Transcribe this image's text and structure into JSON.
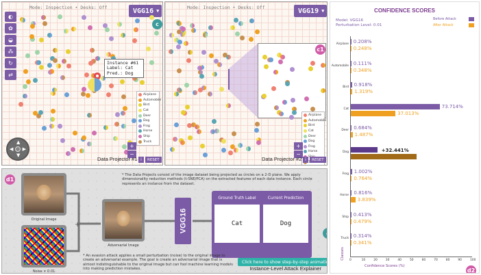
{
  "colors": {
    "accent": "#7b5aa6",
    "before_attack": "#7b5aa6",
    "after_attack": "#f0a020",
    "before_attack_dark": "#5c3a8a",
    "after_attack_dark": "#a06a18",
    "teal_button": "#2fb3a8"
  },
  "projector1": {
    "mode_text": "Mode: Inspection • Desks: Off",
    "model": "VGG16",
    "badge": "c",
    "label": "Data Projector #1",
    "info": "i",
    "reset": "RESET",
    "tooltip": {
      "instance": "Instance #61",
      "label": "Label: Cat",
      "pred": "Pred.: Dog"
    }
  },
  "projector2": {
    "mode_text": "Mode: Inspection • Desks: Off",
    "model": "VGG19",
    "badge": "c1",
    "label": "Data Projector #2",
    "info": "i",
    "reset": "RESET"
  },
  "legend": {
    "classes": [
      {
        "name": "Airplane",
        "color": "#f08070"
      },
      {
        "name": "Automobile",
        "color": "#f0a020"
      },
      {
        "name": "Bird",
        "color": "#e8d030"
      },
      {
        "name": "Cat",
        "color": "#f0e060"
      },
      {
        "name": "Deer",
        "color": "#9fd4a8"
      },
      {
        "name": "Dog",
        "color": "#6aa0d8"
      },
      {
        "name": "Frog",
        "color": "#b090d0"
      },
      {
        "name": "Horse",
        "color": "#5aa5b5"
      },
      {
        "name": "Ship",
        "color": "#d070b0"
      },
      {
        "name": "Truck",
        "color": "#c89050"
      }
    ]
  },
  "explainer": {
    "badge": "d1",
    "original_caption": "Original Image",
    "noise_caption": "Noise × 0.01",
    "adversarial_caption": "Adversarial Image",
    "model": "VGG16",
    "ground_truth_header": "Ground Truth Label",
    "prediction_header": "Current Prediction",
    "ground_truth": "Cat",
    "prediction": "Dog",
    "note_top": "* The Data Projects consist of the image dataset being projected as circles on a 2-D plane. We apply dimensionality reduction methods (t-SNE/PCA) on the extracted features of each data instance. Each circle represents an instance from the dataset.",
    "note_bottom": "* An evasion attack applies a small perturbation (noise) to the original image to create an adversarial example. The goal is create an adversarial image that is almost indistinguishable to the original image but can fool machine learning models into making prediction mistakes.",
    "step_button": "Click here to show step-by-step animation",
    "title": "Instance-Level Attack Explainer",
    "badge_d": "d"
  },
  "confidence": {
    "title": "CONFIDENCE SCORES",
    "model_line": "Model: VGG16",
    "perturbation_line": "Perturbation Level: 0.01",
    "legend_before": "Before Attack",
    "legend_after": "After Attack",
    "badge": "d2",
    "delta": "+32.441%"
  },
  "chart_data": {
    "type": "bar",
    "orientation": "horizontal",
    "title": "CONFIDENCE SCORES",
    "xlabel": "Confidence Scores (%)",
    "ylabel": "Classes",
    "xlim": [
      0,
      100
    ],
    "ticks": [
      "0",
      "10",
      "20",
      "30",
      "40",
      "50",
      "60",
      "70",
      "80",
      "90",
      "100"
    ],
    "categories": [
      "Airplane",
      "Automobile",
      "Bird",
      "Cat",
      "Deer",
      "Dog",
      "Frog",
      "Horse",
      "Ship",
      "Truck"
    ],
    "series": [
      {
        "name": "Before Attack",
        "values": [
          0.208,
          0.111,
          0.918,
          73.714,
          0.684,
          22.0,
          1.002,
          0.816,
          0.413,
          0.314
        ],
        "labels": [
          "0.208%",
          "0.111%",
          "0.918%",
          "73.714%",
          "0.684%",
          "",
          "1.002%",
          "0.816%",
          "0.413%",
          "0.314%"
        ]
      },
      {
        "name": "After Attack",
        "values": [
          0.248,
          0.348,
          1.319,
          37.013,
          1.487,
          54.441,
          0.764,
          3.839,
          0.479,
          0.341
        ],
        "labels": [
          "0.248%",
          "0.348%",
          "1.319%",
          "37.013%",
          "1.487%",
          "",
          "0.764%",
          "3.839%",
          "0.479%",
          "0.341%"
        ]
      }
    ],
    "annotation": {
      "category": "Dog",
      "text": "+32.441%"
    }
  }
}
